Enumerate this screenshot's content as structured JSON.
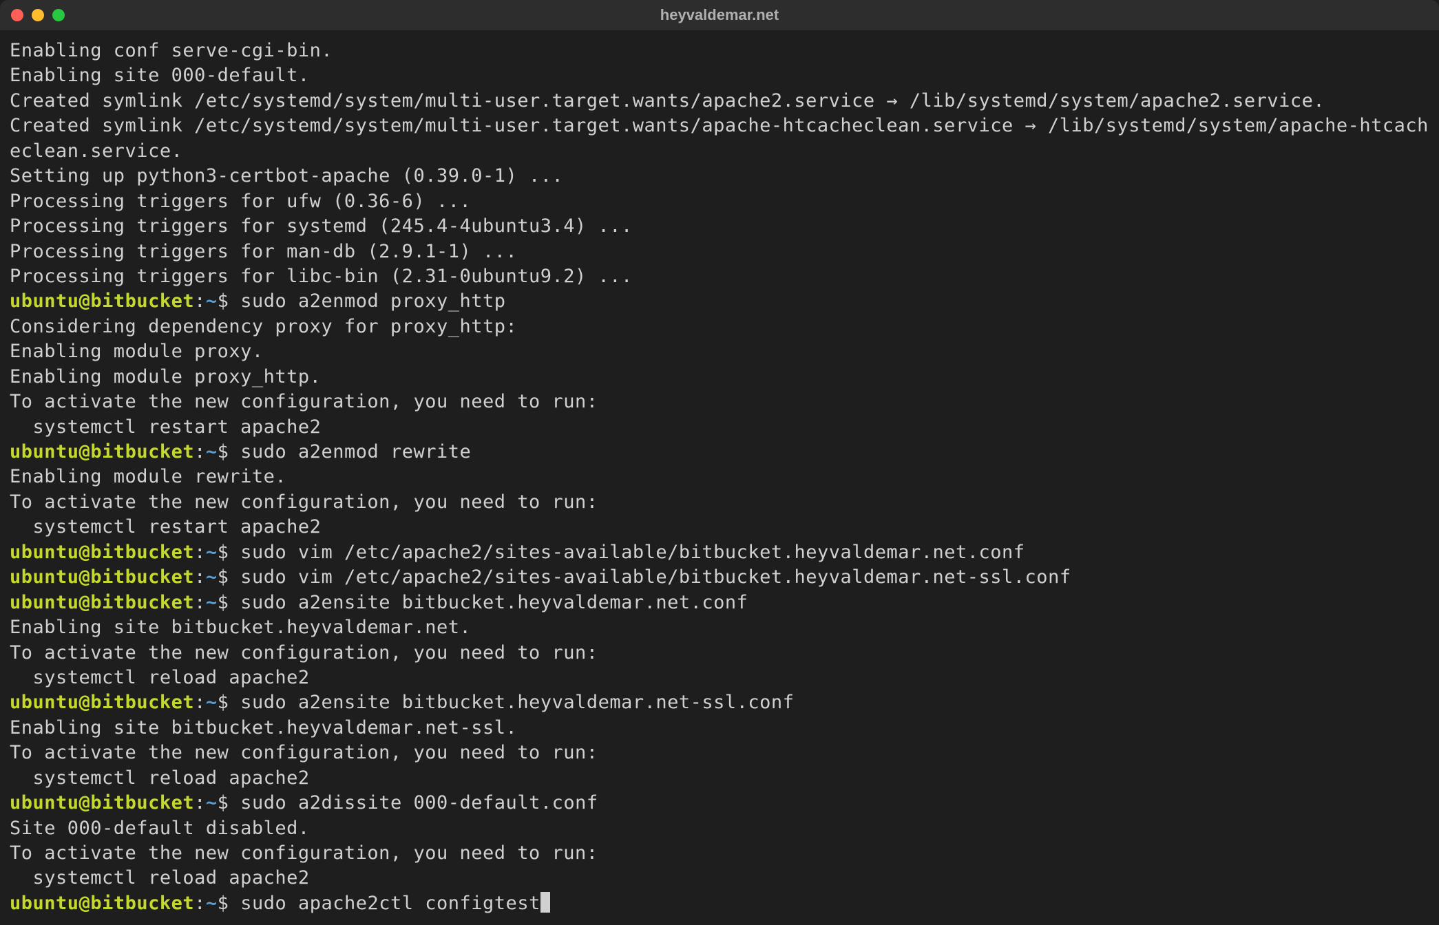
{
  "window": {
    "title": "heyvaldemar.net"
  },
  "prompt": {
    "user": "ubuntu",
    "at": "@",
    "host": "bitbucket",
    "colon": ":",
    "path": "~",
    "symbol": "$"
  },
  "lines": [
    {
      "type": "output",
      "text": "Enabling conf serve-cgi-bin."
    },
    {
      "type": "output",
      "text": "Enabling site 000-default."
    },
    {
      "type": "output",
      "text": "Created symlink /etc/systemd/system/multi-user.target.wants/apache2.service → /lib/systemd/system/apache2.service."
    },
    {
      "type": "output",
      "text": "Created symlink /etc/systemd/system/multi-user.target.wants/apache-htcacheclean.service → /lib/systemd/system/apache-htcacheclean.service."
    },
    {
      "type": "output",
      "text": "Setting up python3-certbot-apache (0.39.0-1) ..."
    },
    {
      "type": "output",
      "text": "Processing triggers for ufw (0.36-6) ..."
    },
    {
      "type": "output",
      "text": "Processing triggers for systemd (245.4-4ubuntu3.4) ..."
    },
    {
      "type": "output",
      "text": "Processing triggers for man-db (2.9.1-1) ..."
    },
    {
      "type": "output",
      "text": "Processing triggers for libc-bin (2.31-0ubuntu9.2) ..."
    },
    {
      "type": "prompt",
      "command": "sudo a2enmod proxy_http"
    },
    {
      "type": "output",
      "text": "Considering dependency proxy for proxy_http:"
    },
    {
      "type": "output",
      "text": "Enabling module proxy."
    },
    {
      "type": "output",
      "text": "Enabling module proxy_http."
    },
    {
      "type": "output",
      "text": "To activate the new configuration, you need to run:"
    },
    {
      "type": "output",
      "text": "  systemctl restart apache2"
    },
    {
      "type": "prompt",
      "command": "sudo a2enmod rewrite"
    },
    {
      "type": "output",
      "text": "Enabling module rewrite."
    },
    {
      "type": "output",
      "text": "To activate the new configuration, you need to run:"
    },
    {
      "type": "output",
      "text": "  systemctl restart apache2"
    },
    {
      "type": "prompt",
      "command": "sudo vim /etc/apache2/sites-available/bitbucket.heyvaldemar.net.conf"
    },
    {
      "type": "prompt",
      "command": "sudo vim /etc/apache2/sites-available/bitbucket.heyvaldemar.net-ssl.conf"
    },
    {
      "type": "prompt",
      "command": "sudo a2ensite bitbucket.heyvaldemar.net.conf"
    },
    {
      "type": "output",
      "text": "Enabling site bitbucket.heyvaldemar.net."
    },
    {
      "type": "output",
      "text": "To activate the new configuration, you need to run:"
    },
    {
      "type": "output",
      "text": "  systemctl reload apache2"
    },
    {
      "type": "prompt",
      "command": "sudo a2ensite bitbucket.heyvaldemar.net-ssl.conf"
    },
    {
      "type": "output",
      "text": "Enabling site bitbucket.heyvaldemar.net-ssl."
    },
    {
      "type": "output",
      "text": "To activate the new configuration, you need to run:"
    },
    {
      "type": "output",
      "text": "  systemctl reload apache2"
    },
    {
      "type": "prompt",
      "command": "sudo a2dissite 000-default.conf"
    },
    {
      "type": "output",
      "text": "Site 000-default disabled."
    },
    {
      "type": "output",
      "text": "To activate the new configuration, you need to run:"
    },
    {
      "type": "output",
      "text": "  systemctl reload apache2"
    },
    {
      "type": "prompt",
      "command": "sudo apache2ctl configtest",
      "cursor": true
    }
  ]
}
